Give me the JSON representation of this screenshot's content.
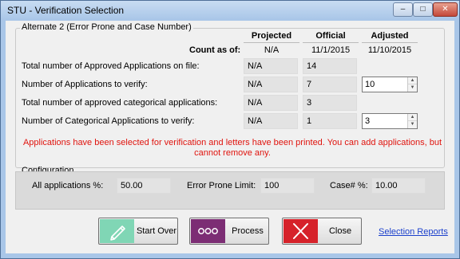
{
  "window": {
    "title": "STU - Verification Selection",
    "minimize_glyph": "‒",
    "maximize_glyph": "□",
    "close_glyph": "✕"
  },
  "group": {
    "legend": "Alternate 2 (Error Prone and Case Number)"
  },
  "columns": {
    "projected": "Projected",
    "official": "Official",
    "adjusted": "Adjusted"
  },
  "count_as_of": {
    "label": "Count as of:",
    "projected": "N/A",
    "official": "11/1/2015",
    "adjusted": "11/10/2015"
  },
  "rows": [
    {
      "label": "Total number of Approved Applications on file:",
      "projected": "N/A",
      "official": "14"
    },
    {
      "label": "Number of Applications to verify:",
      "projected": "N/A",
      "official": "7",
      "adjusted": "10"
    },
    {
      "label": "Total number of approved categorical applications:",
      "projected": "N/A",
      "official": "3"
    },
    {
      "label": "Number of Categorical Applications to verify:",
      "projected": "N/A",
      "official": "1",
      "adjusted": "3"
    }
  ],
  "warning": "Applications have been selected for verification and letters have been printed. You can add applications, but cannot remove any.",
  "configuration": {
    "legend": "Configuration",
    "all_label": "All applications %:",
    "all_value": "50.00",
    "error_label": "Error Prone Limit:",
    "error_value": "100",
    "case_label": "Case# %:",
    "case_value": "10.00"
  },
  "buttons": {
    "start_over": "Start Over",
    "process": "Process",
    "close": "Close"
  },
  "links": {
    "selection_reports": "Selection Reports"
  },
  "colors": {
    "title_bar": "#a9c6e8",
    "warning": "#e0140e",
    "start_over_icon": "#80d6b5",
    "process_icon": "#7c2d74",
    "close_icon": "#d6222a",
    "link": "#1a3fcc"
  },
  "icons": {
    "start_over": "pencil-icon",
    "process": "dots-icon",
    "close": "x-icon"
  }
}
